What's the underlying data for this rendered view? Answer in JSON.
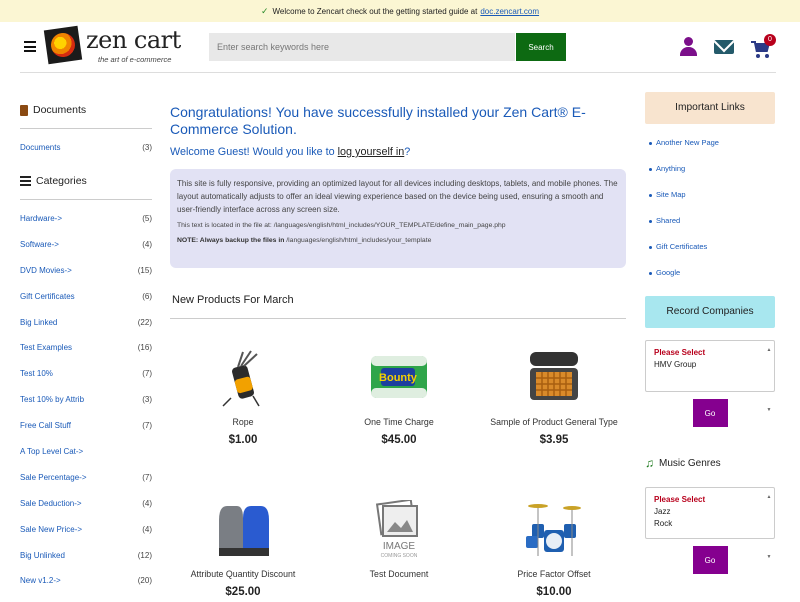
{
  "topbar": {
    "message": "Welcome to Zencart check out the getting started guide at",
    "link": "doc.zencart.com"
  },
  "header": {
    "logo_text": "zen cart",
    "logo_tagline": "the art of e-commerce",
    "search_placeholder": "Enter search keywords here",
    "search_button": "Search",
    "cart_count": "0"
  },
  "left": {
    "documents_heading": "Documents",
    "documents": [
      {
        "label": "Documents",
        "count": "(3)"
      }
    ],
    "categories_heading": "Categories",
    "categories": [
      {
        "label": "Hardware->",
        "count": "(5)"
      },
      {
        "label": "Software->",
        "count": "(4)"
      },
      {
        "label": "DVD Movies->",
        "count": "(15)"
      },
      {
        "label": "Gift Certificates",
        "count": "(6)"
      },
      {
        "label": "Big Linked",
        "count": "(22)"
      },
      {
        "label": "Test Examples",
        "count": "(16)"
      },
      {
        "label": "Test 10%",
        "count": "(7)"
      },
      {
        "label": "Test 10% by Attrib",
        "count": "(3)"
      },
      {
        "label": "Free Call Stuff",
        "count": "(7)"
      },
      {
        "label": "A Top Level Cat->",
        "count": ""
      },
      {
        "label": "Sale Percentage->",
        "count": "(7)"
      },
      {
        "label": "Sale Deduction->",
        "count": "(4)"
      },
      {
        "label": "Sale New Price->",
        "count": "(4)"
      },
      {
        "label": "Big Unlinked",
        "count": "(12)"
      },
      {
        "label": "New v1.2->",
        "count": "(20)"
      }
    ]
  },
  "main": {
    "congrats": "Congratulations! You have successfully installed your Zen Cart® E-Commerce Solution.",
    "welcome_prefix": "Welcome Guest! Would you like to",
    "welcome_link": "log yourself in",
    "welcome_suffix": "?",
    "info_text": "This site is fully responsive, providing an optimized layout for all devices including desktops, tablets, and mobile phones. The layout automatically adjusts to offer an ideal viewing experience based on the device being used, ensuring a smooth and user-friendly interface across any screen size.",
    "info_file": "This text is located in the file at: /languages/english/html_includes/YOUR_TEMPLATE/define_main_page.php",
    "info_note_label": "NOTE: Always backup the files in",
    "info_note_path": "/languages/english/html_includes/your_template",
    "new_products_heading": "New Products For March",
    "products": [
      {
        "name": "Rope",
        "price": "$1.00",
        "icon": "golf-bag-icon"
      },
      {
        "name": "One Time Charge",
        "price": "$45.00",
        "icon": "paper-towel-icon"
      },
      {
        "name": "Sample of Product General Type",
        "price": "$3.95",
        "icon": "waffle-maker-icon"
      },
      {
        "name": "Attribute Quantity Discount",
        "price": "$25.00",
        "icon": "gloves-icon"
      },
      {
        "name": "Test Document",
        "price": "",
        "icon": "image-placeholder-icon",
        "placeholder_text": "IMAGE",
        "placeholder_sub": "COMING SOON"
      },
      {
        "name": "Price Factor Offset",
        "price": "$10.00",
        "icon": "drum-kit-icon"
      }
    ]
  },
  "right": {
    "important_links_heading": "Important Links",
    "links": [
      "Another New Page",
      "Anything",
      "Site Map",
      "Shared",
      "Gift Certificates",
      "Google"
    ],
    "record_companies_heading": "Record Companies",
    "record_select": {
      "prompt": "Please Select",
      "options": [
        "HMV Group"
      ]
    },
    "go_label": "Go",
    "music_genres_heading": "Music Genres",
    "genre_select": {
      "prompt": "Please Select",
      "options": [
        "Jazz",
        "Rock"
      ]
    }
  },
  "colors": {
    "link_blue": "#1a5ab8",
    "search_green": "#0d6a12",
    "go_purple": "#85008f",
    "topbar_yellow": "#fbf6d3",
    "info_lavender": "#e2e2f4"
  }
}
